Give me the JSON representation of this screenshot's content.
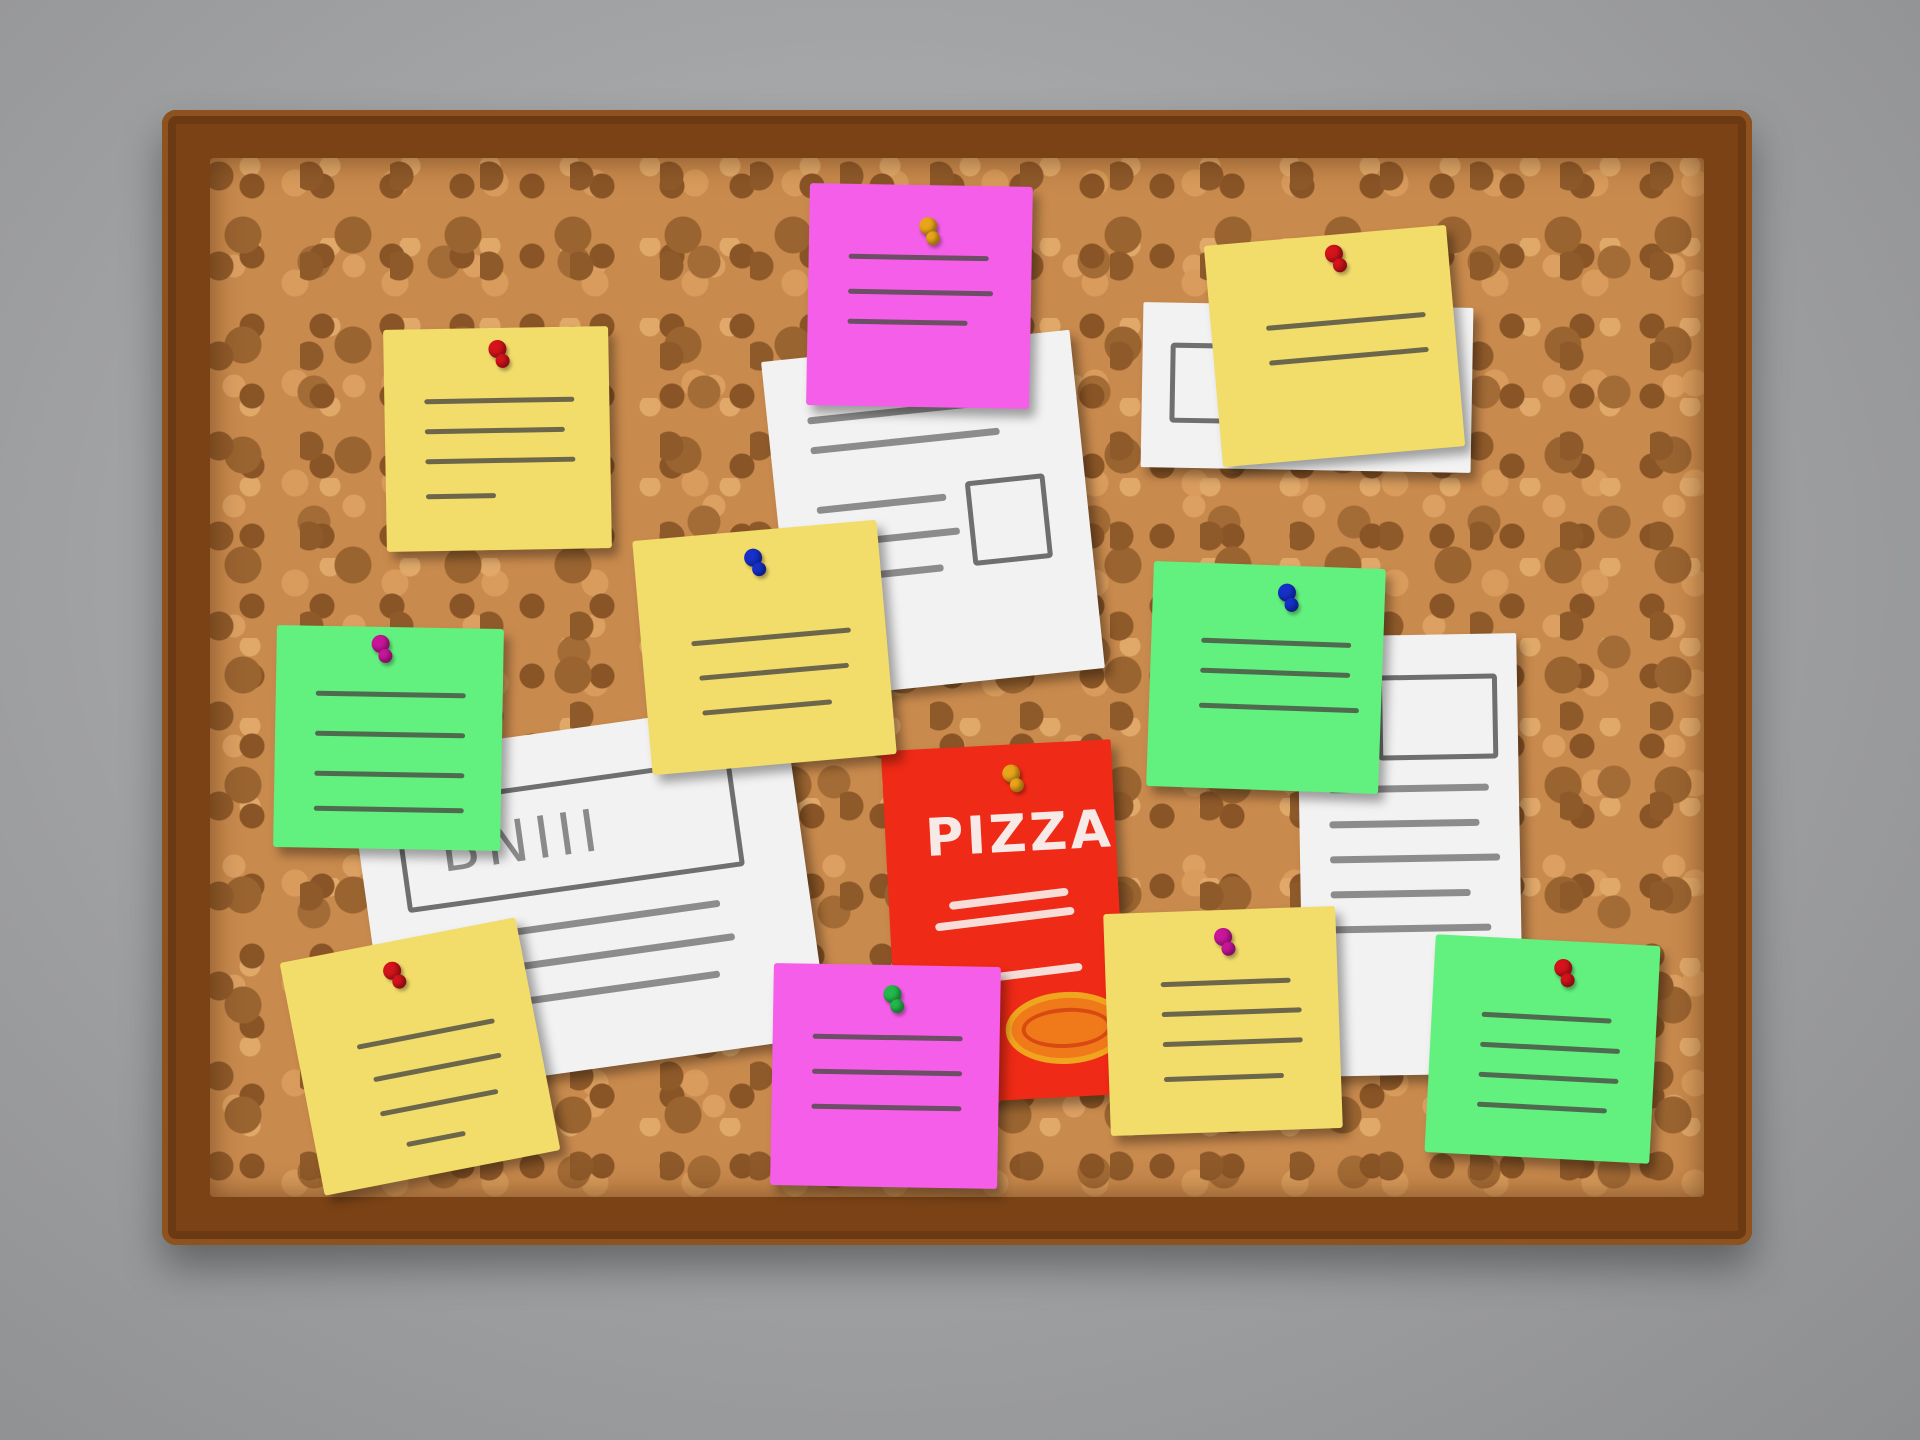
{
  "board": {
    "frame_color": "#7a4215",
    "cork_color": "#c98a4d"
  },
  "colors": {
    "yellow_note": "#f2dc6a",
    "green_note": "#62f07e",
    "pink_note": "#f55ee8",
    "pizza_flyer": "#ef2a16",
    "paper": "#f2f2f2"
  },
  "pizza_flyer": {
    "title": "PIZZA",
    "icon": "pizza-icon"
  },
  "flyer": {
    "text": "BNIII"
  },
  "pins": [
    "red",
    "blue",
    "magenta",
    "orange",
    "purple",
    "green"
  ]
}
